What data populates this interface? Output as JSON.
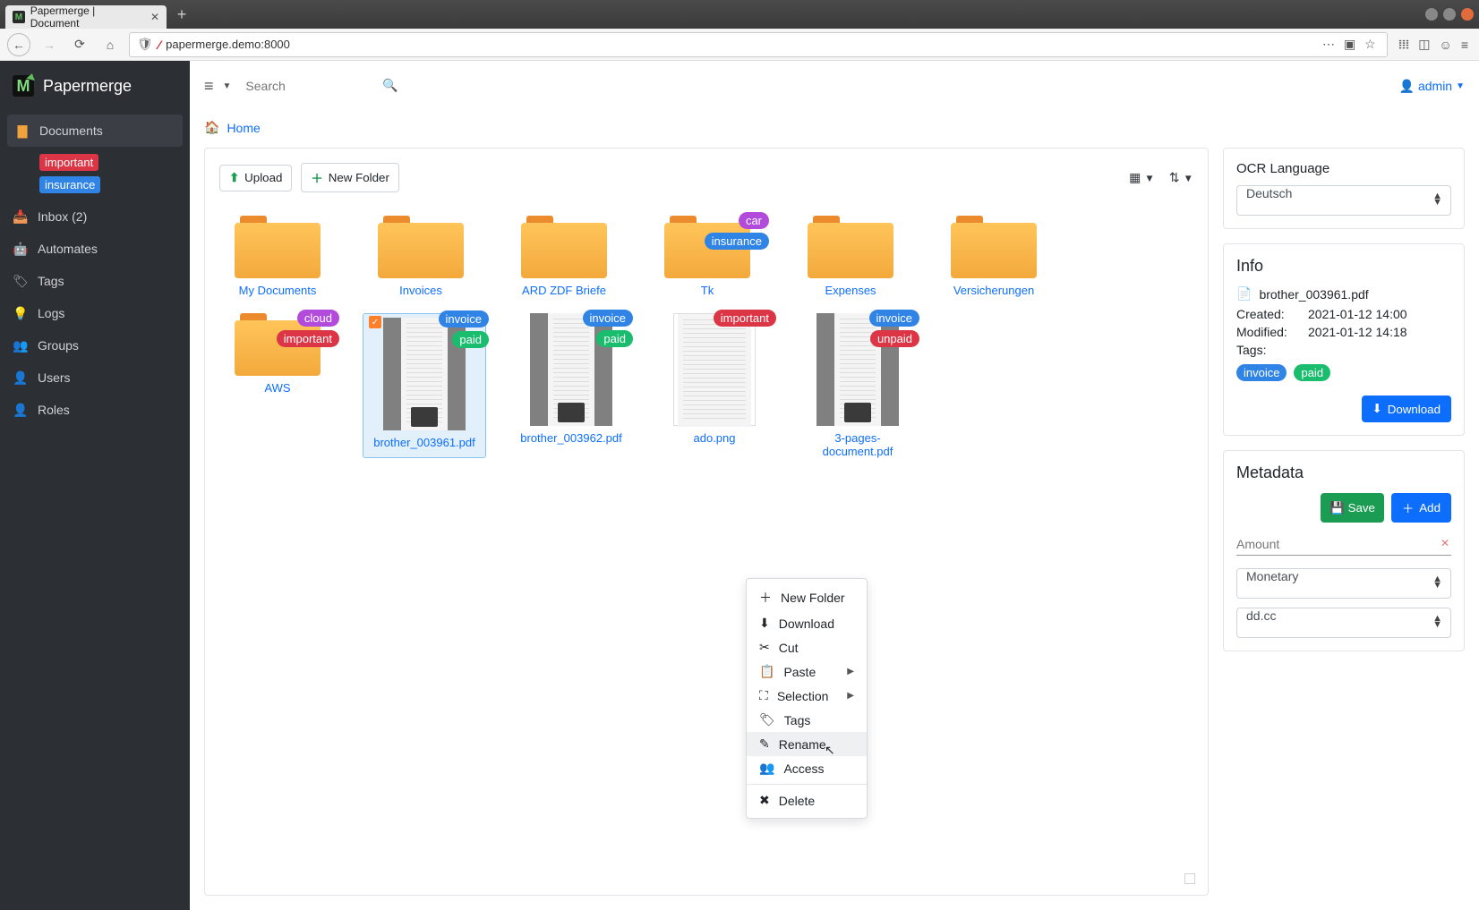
{
  "os": {
    "tab_title": "Papermerge | Document",
    "url": "papermerge.demo:8000"
  },
  "brand": "Papermerge",
  "sidebar": {
    "documents": "Documents",
    "tag_important": "important",
    "tag_insurance": "insurance",
    "inbox": "Inbox (2)",
    "automates": "Automates",
    "tags": "Tags",
    "logs": "Logs",
    "groups": "Groups",
    "users": "Users",
    "roles": "Roles"
  },
  "top": {
    "search_placeholder": "Search",
    "user": "admin"
  },
  "crumb": {
    "home": "Home"
  },
  "toolbar": {
    "upload": "Upload",
    "new_folder": "New Folder"
  },
  "items": {
    "my_documents": "My Documents",
    "invoices": "Invoices",
    "ard": "ARD ZDF Briefe",
    "tk": "Tk",
    "expenses": "Expenses",
    "versicherungen": "Versicherungen",
    "aws": "AWS",
    "b1": "brother_003961.pdf",
    "b2": "brother_003962.pdf",
    "ado": "ado.png",
    "three": "3-pages-document.pdf"
  },
  "tags": {
    "car": "car",
    "insurance": "insurance",
    "cloud": "cloud",
    "important": "important",
    "invoice": "invoice",
    "paid": "paid",
    "unpaid": "unpaid"
  },
  "ctx": {
    "new_folder": "New Folder",
    "download": "Download",
    "cut": "Cut",
    "paste": "Paste",
    "selection": "Selection",
    "tags": "Tags",
    "rename": "Rename",
    "access": "Access",
    "delete": "Delete"
  },
  "ocr": {
    "title": "OCR Language",
    "value": "Deutsch"
  },
  "info": {
    "title": "Info",
    "filename": "brother_003961.pdf",
    "created_k": "Created:",
    "created_v": "2021-01-12 14:00",
    "modified_k": "Modified:",
    "modified_v": "2021-01-12 14:18",
    "tags_k": "Tags:",
    "download": "Download"
  },
  "meta": {
    "title": "Metadata",
    "save": "Save",
    "add": "Add",
    "amount_ph": "Amount",
    "type": "Monetary",
    "fmt": "dd.cc"
  }
}
